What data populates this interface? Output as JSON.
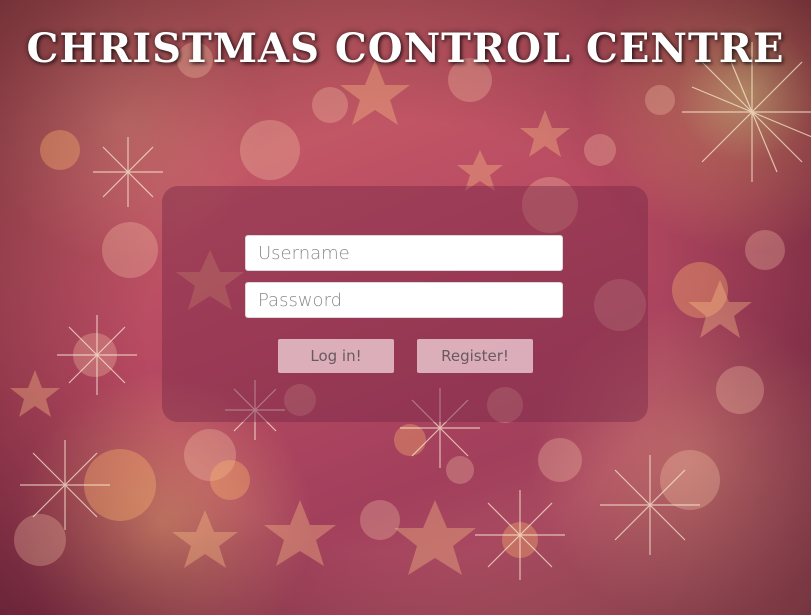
{
  "page": {
    "title": "CHRISTMAS CONTROL CENTRE"
  },
  "login_form": {
    "username_placeholder": "Username",
    "password_placeholder": "Password",
    "login_label": "Log in!",
    "register_label": "Register!"
  },
  "colors": {
    "background_primary": "#b5485a",
    "panel": "rgba(120,40,70,0.45)",
    "button": "#ebc8d2",
    "title_text": "#ffffff"
  }
}
